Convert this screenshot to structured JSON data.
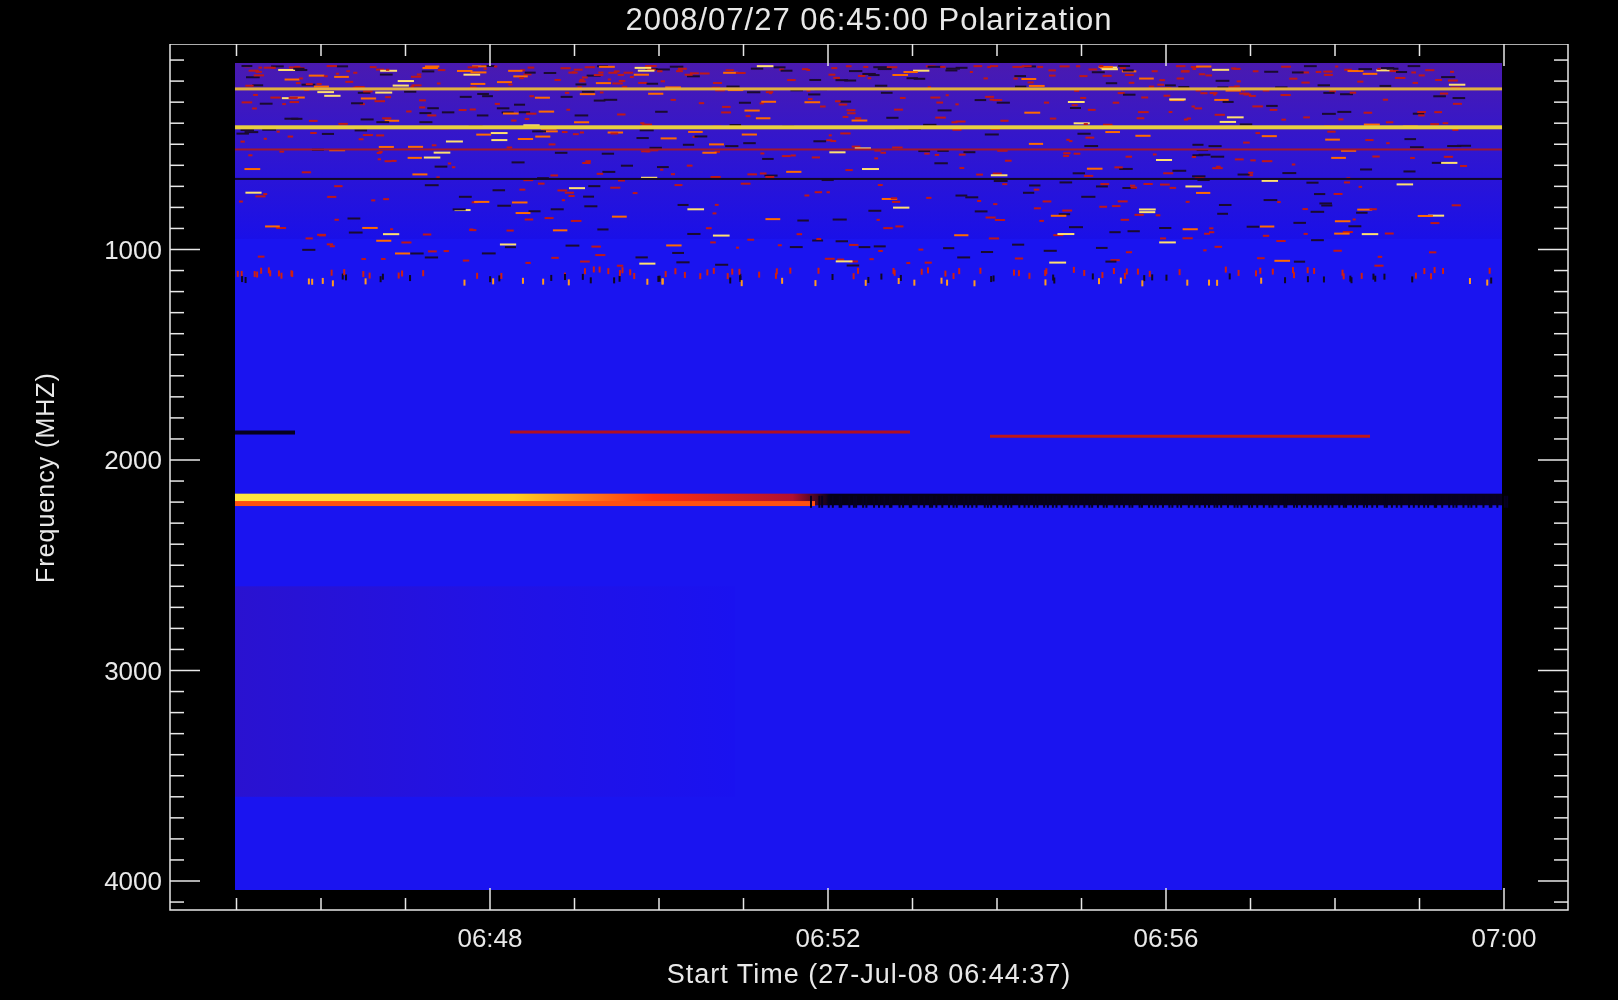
{
  "title": "2008/07/27 06:45:00 Polarization",
  "y_axis": {
    "label": "Frequency (MHZ)",
    "ticks": [
      "1000",
      "2000",
      "3000",
      "4000"
    ]
  },
  "x_axis": {
    "label": "Start Time (27-Jul-08 06:44:37)",
    "ticks": [
      "06:48",
      "06:52",
      "06:56",
      "07:00"
    ]
  }
}
